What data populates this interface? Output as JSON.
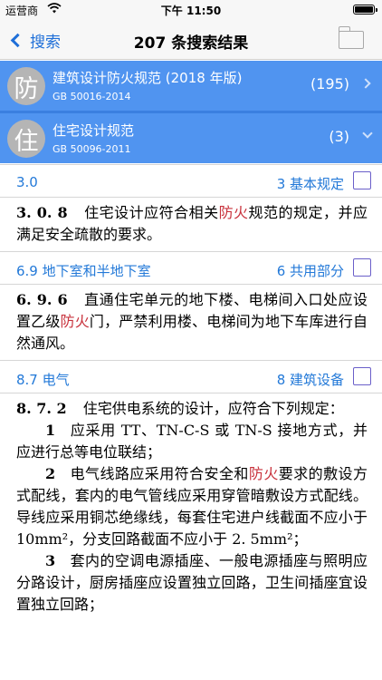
{
  "status_bar": {
    "carrier": "运营商",
    "time": "下午 11:50"
  },
  "nav": {
    "back_label": "搜索",
    "title": "207 条搜索结果"
  },
  "documents": [
    {
      "badge": "防",
      "title": "建筑设计防火规范 (2018 年版)",
      "code": "GB 50016-2014",
      "count": "(195)",
      "expanded": false
    },
    {
      "badge": "住",
      "title": "住宅设计规范",
      "code": "GB 50096-2011",
      "count": "(3)",
      "expanded": true
    }
  ],
  "results": [
    {
      "section": "3.0",
      "chapter": "3 基本规定",
      "number": "3. 0. 8",
      "text_before": "住宅设计应符合相关",
      "highlight": "防火",
      "text_after": "规范的规定，并应满足安全疏散的要求。"
    },
    {
      "section": "6.9 地下室和半地下室",
      "chapter": "6 共用部分",
      "number": "6. 9. 6",
      "text_before": "直通住宅单元的地下楼、电梯间入口处应设置乙级",
      "highlight": "防火",
      "text_after": "门，严禁利用楼、电梯间为地下车库进行自然通风。"
    },
    {
      "section": "8.7 电气",
      "chapter": "8 建筑设备",
      "number": "8. 7. 2",
      "intro": "住宅供电系统的设计，应符合下列规定：",
      "items": [
        {
          "n": "1",
          "text": "应采用 TT、TN-C-S 或 TN-S 接地方式，并应进行总等电位联结；"
        },
        {
          "n": "2",
          "text_before": "电气线路应采用符合安全和",
          "highlight": "防火",
          "text_after": "要求的敷设方式配线，套内的电气管线应采用穿管暗敷设方式配线。导线应采用铜芯绝缘线，每套住宅进户线截面不应小于 10mm²，分支回路截面不应小于 2. 5mm²；"
        },
        {
          "n": "3",
          "text": "套内的空调电源插座、一般电源插座与照明应分路设计，厨房插座应设置独立回路，卫生间插座宜设置独立回路；"
        }
      ]
    }
  ]
}
